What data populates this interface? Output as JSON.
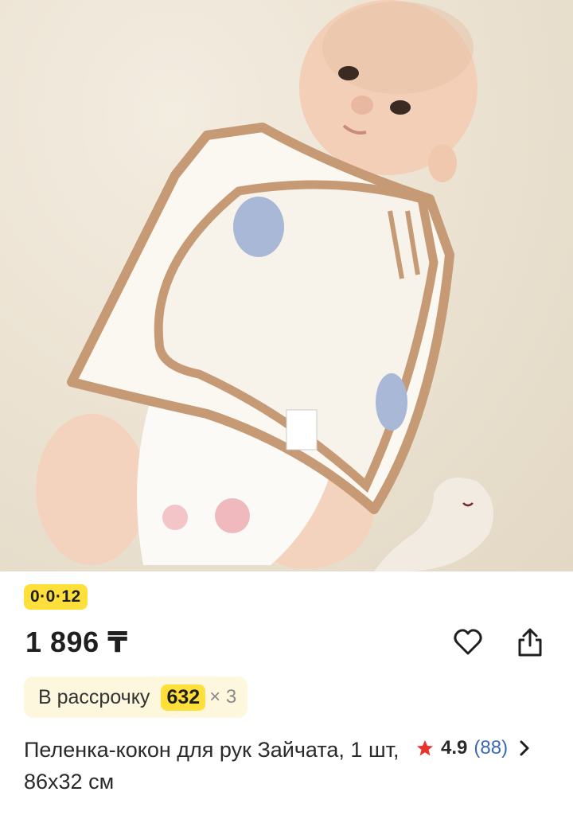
{
  "product": {
    "photo_alt": "Peленка-кокон baby photo",
    "timer": "0·0·12",
    "price": "1 896 ₸",
    "installment": {
      "label": "В рассрочку",
      "amount": "632",
      "multiplier": "× 3"
    },
    "title": "Пеленка-кокон для рук Зайчата, 1 шт, 86х32 см",
    "rating": {
      "value": "4.9",
      "count": "(88)"
    }
  },
  "colors": {
    "accent_yellow": "#ffe03a",
    "installment_bg": "#fdf7dd",
    "star": "#e8322b",
    "link_blue": "#3a68b8"
  },
  "icons": [
    "heart-icon",
    "share-icon",
    "star-icon",
    "chevron-right-icon"
  ]
}
